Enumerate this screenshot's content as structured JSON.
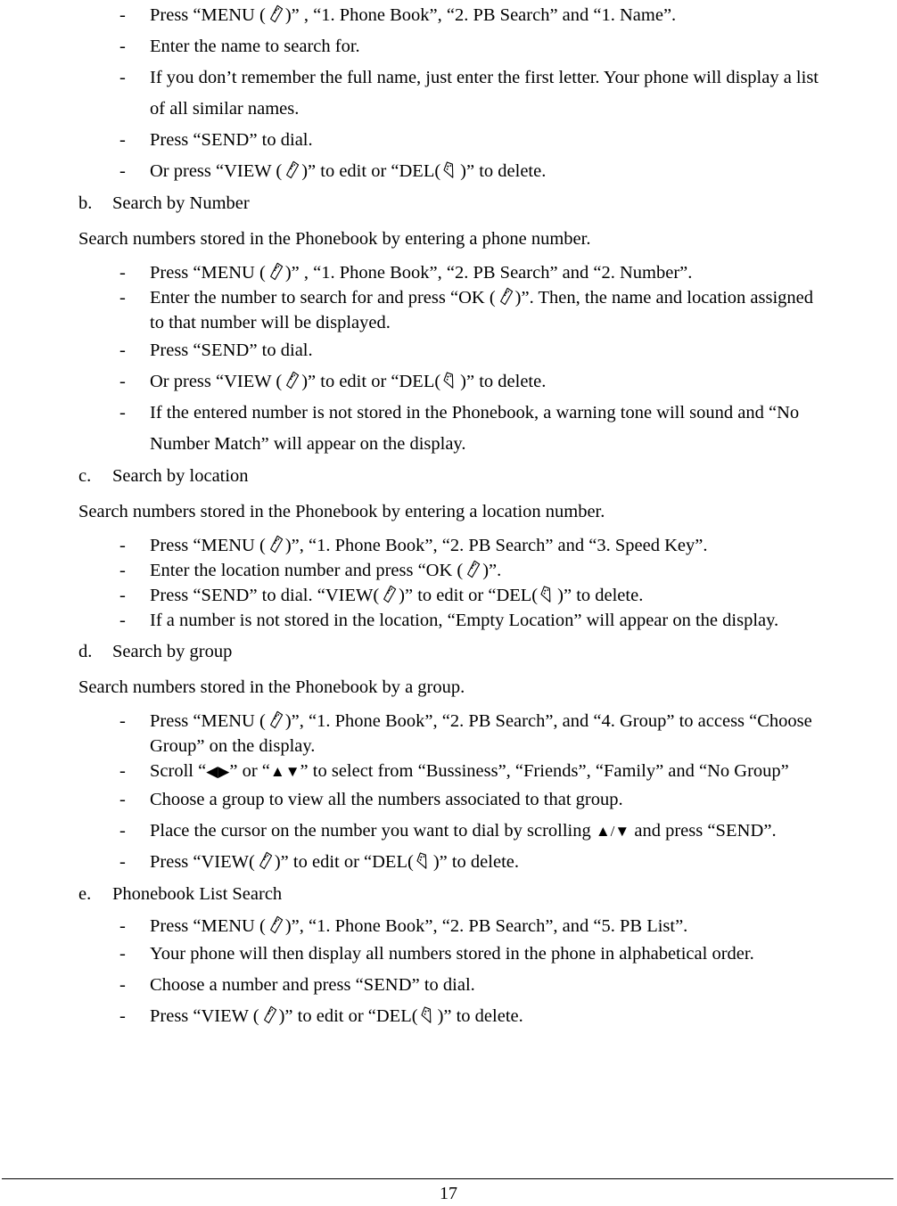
{
  "document": {
    "page_number": "17",
    "icons": {
      "menu_key": "menu-key-icon",
      "view_key": "view-key-icon",
      "ok_key": "ok-key-icon",
      "del_key": "del-key-icon"
    }
  },
  "blocks": {
    "a_items": {
      "item1_pre": "Press “MENU (",
      "item1_post": ")” , “1. Phone Book”, “2. PB Search” and “1. Name”.",
      "item2": "Enter the name to search for.",
      "item3": "If you don’t remember the full name, just enter the first letter.    Your phone will display a list of all similar names.",
      "item4_pre": "Press “",
      "item4_send": "SEND",
      "item4_post": "” to dial.",
      "item5_pre": "Or press “VIEW (",
      "item5_mid": ")” to edit or “DEL(",
      "item5_post": ")” to delete."
    },
    "b": {
      "letter": "b.",
      "title": "Search by Number",
      "intro": "Search numbers stored in the Phonebook by entering a phone number.",
      "item1_pre": "Press “MENU (",
      "item1_post": ")” , “1. Phone Book”, “2. PB Search” and “2. Number”.",
      "item2_pre": "Enter the number to search for and press “OK (",
      "item2_post": ")”. Then, the name and location assigned to that number will be displayed.",
      "item3_pre": "Press “",
      "item3_send": "SEND",
      "item3_post": "” to dial.",
      "item4_pre": "Or press “VIEW (",
      "item4_mid": ")” to edit or “DEL(",
      "item4_post": ")” to delete.",
      "item5": "If the entered number is not stored in the Phonebook, a warning tone will sound and “No Number Match” will appear on the display."
    },
    "c": {
      "letter": "c.",
      "title": "Search by location",
      "intro": "Search numbers stored in the Phonebook by entering a location number.",
      "item1_pre": "Press “MENU (",
      "item1_post": ")”, “1. Phone Book”, “2. PB Search” and “3. Speed Key”.",
      "item2_pre": "Enter the location number and press “OK (",
      "item2_post": ")”.",
      "item3_pre": "Press “",
      "item3_send": "SEND",
      "item3_mid1": "” to dial. “VIEW(",
      "item3_mid2": ")” to edit or “DEL(",
      "item3_post": ")” to delete.",
      "item4": "If a number is not stored in the location, “Empty Location” will appear on the display."
    },
    "d": {
      "letter": "d.",
      "title": "Search by group",
      "intro": "Search numbers stored in the Phonebook by a group.",
      "item1_pre": "Press “MENU (",
      "item1_post": ")”, “1. Phone Book”, “2. PB Search”, and “4. Group” to access “Choose Group” on the display.",
      "item2_pre": "Scroll “",
      "item2_arrows1": "◀▶",
      "item2_mid": "” or “",
      "item2_arrows2": "▲▼",
      "item2_post": "” to select from “Bussiness”, “Friends”, “Family” and “No Group”",
      "item3": "Choose a group to view all the numbers associated to that group.",
      "item4_pre": "Place the cursor on the number you want to dial by scrolling  ",
      "item4_arrows": "▲/▼",
      "item4_mid": "  and press “",
      "item4_send": "SEND",
      "item4_post": "”.",
      "item5_pre": "Press “VIEW(",
      "item5_mid": ")” to edit or “DEL(",
      "item5_post": ")” to delete."
    },
    "e": {
      "letter": "e.",
      "title": "Phonebook List Search",
      "item1_pre": "Press “MENU (",
      "item1_post": ")”, “1. Phone Book”, “2. PB Search”, and “5. PB List”.",
      "item2": "Your phone will then display all numbers stored in the phone in alphabetical order.",
      "item3_pre": "Choose a number and press “",
      "item3_send": "SEND",
      "item3_post": "” to dial.",
      "item4_pre": "Press “VIEW (",
      "item4_mid": ")” to edit or “DEL(",
      "item4_post": ")” to delete."
    },
    "dash": "-"
  }
}
